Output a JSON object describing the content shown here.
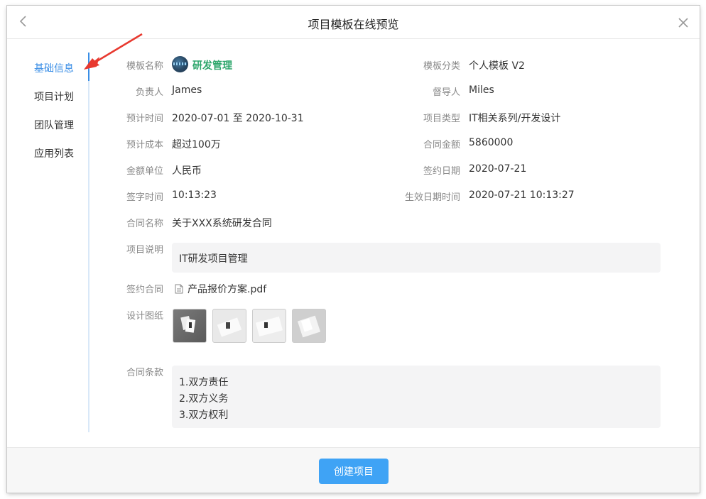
{
  "modal": {
    "title": "项目模板在线预览"
  },
  "sidenav": {
    "items": [
      {
        "label": "基础信息",
        "active": true
      },
      {
        "label": "项目计划",
        "active": false
      },
      {
        "label": "团队管理",
        "active": false
      },
      {
        "label": "应用列表",
        "active": false
      }
    ]
  },
  "info": {
    "template_name": {
      "label": "模板名称",
      "value": "研发管理"
    },
    "template_category": {
      "label": "模板分类",
      "value": "个人模板 V2"
    },
    "owner": {
      "label": "负责人",
      "value": "James"
    },
    "supervisor": {
      "label": "督导人",
      "value": "Miles"
    },
    "planned_time": {
      "label": "预计时间",
      "value": "2020-07-01 至 2020-10-31"
    },
    "project_type": {
      "label": "项目类型",
      "value": "IT相关系列/开发设计"
    },
    "estimated_cost": {
      "label": "预计成本",
      "value": "超过100万"
    },
    "contract_amount": {
      "label": "合同金额",
      "value": "5860000"
    },
    "currency_unit": {
      "label": "金额单位",
      "value": "人民币"
    },
    "sign_date": {
      "label": "签约日期",
      "value": "2020-07-21"
    },
    "sign_time": {
      "label": "签字时间",
      "value": "10:13:23"
    },
    "effective_datetime": {
      "label": "生效日期时间",
      "value": "2020-07-21 10:13:27"
    },
    "contract_name": {
      "label": "合同名称",
      "value": "关于XXX系统研发合同"
    },
    "project_desc": {
      "label": "项目说明",
      "value": "IT研发项目管理"
    },
    "signed_contract": {
      "label": "签约合同",
      "file": "产品报价方案.pdf"
    },
    "design_drawings": {
      "label": "设计图纸"
    },
    "contract_terms": {
      "label": "合同条款",
      "lines": [
        "1.双方责任",
        "2.双方义务",
        "3.双方权利"
      ]
    }
  },
  "footer": {
    "create_label": "创建项目"
  },
  "colors": {
    "accent": "#3a8ee6",
    "button": "#3fa3f5",
    "template_name": "#2ba56a",
    "arrow": "#e8392f"
  }
}
